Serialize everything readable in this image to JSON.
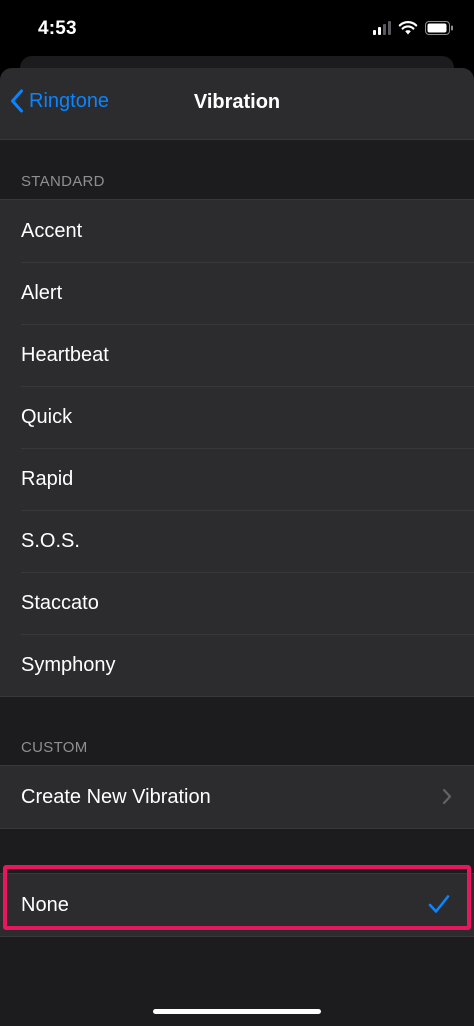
{
  "status_bar": {
    "time": "4:53"
  },
  "nav": {
    "back_label": "Ringtone",
    "title": "Vibration"
  },
  "standard": {
    "header": "STANDARD",
    "items": [
      {
        "label": "Accent"
      },
      {
        "label": "Alert"
      },
      {
        "label": "Heartbeat"
      },
      {
        "label": "Quick"
      },
      {
        "label": "Rapid"
      },
      {
        "label": "S.O.S."
      },
      {
        "label": "Staccato"
      },
      {
        "label": "Symphony"
      }
    ]
  },
  "custom": {
    "header": "CUSTOM",
    "create_label": "Create New Vibration"
  },
  "none": {
    "label": "None",
    "selected": true
  },
  "colors": {
    "accent": "#0a84ff",
    "highlight": "#e8175d",
    "background": "#1c1c1e",
    "cell": "#2c2c2e"
  }
}
